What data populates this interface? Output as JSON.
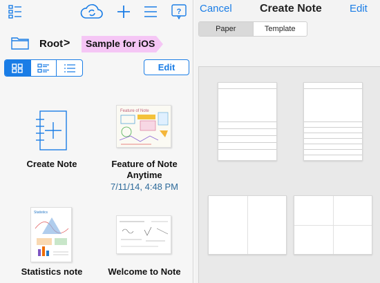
{
  "toolbar": {
    "icons": [
      "list-menu-icon",
      "cloud-sync-icon",
      "plus-icon",
      "hamburger-icon",
      "help-icon"
    ],
    "accent_color": "#1a7de6"
  },
  "breadcrumb": {
    "root": "Root",
    "separator": ">",
    "current": "Sample for iOS",
    "current_tag_color": "#f5c6f5"
  },
  "view_modes": [
    "grid",
    "detail-list",
    "list"
  ],
  "edit_label": "Edit",
  "notes": [
    {
      "title": "Create Note",
      "date": ""
    },
    {
      "title": "Feature of Note Anytime",
      "date": "7/11/14, 4:48 PM"
    },
    {
      "title": "Statistics note",
      "date": ""
    },
    {
      "title": "Welcome to Note",
      "date": ""
    }
  ],
  "create_panel": {
    "cancel": "Cancel",
    "title": "Create Note",
    "edit": "Edit",
    "tabs": [
      "Paper",
      "Template"
    ],
    "selected_tab": "Paper"
  }
}
